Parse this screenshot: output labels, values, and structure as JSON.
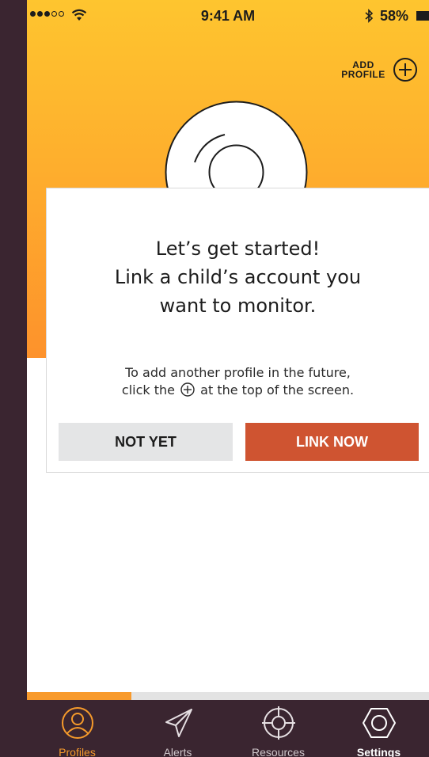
{
  "status_bar": {
    "time": "9:41 AM",
    "battery": "58%",
    "signal_bars_filled": 3,
    "signal_bars_total": 5
  },
  "header": {
    "add_profile_label": "ADD\nPROFILE"
  },
  "modal": {
    "title": "Let’s get started!\nLink a child’s account you\nwant to monitor.",
    "hint_before": "To add another profile in the future,\nclick the",
    "hint_after": "at the top of the screen.",
    "secondary_button": "NOT YET",
    "primary_button": "LINK NOW"
  },
  "progress": {
    "fraction": 0.26
  },
  "tabs": [
    {
      "label": "Profiles",
      "icon": "profile-icon",
      "state": "active"
    },
    {
      "label": "Alerts",
      "icon": "paper-plane-icon",
      "state": "normal"
    },
    {
      "label": "Resources",
      "icon": "lifebuoy-icon",
      "state": "normal"
    },
    {
      "label": "Settings",
      "icon": "hex-nut-icon",
      "state": "bold"
    }
  ],
  "colors": {
    "accent": "#f59a2b",
    "primary_button": "#cf5431",
    "tab_bar": "#3a2530"
  }
}
